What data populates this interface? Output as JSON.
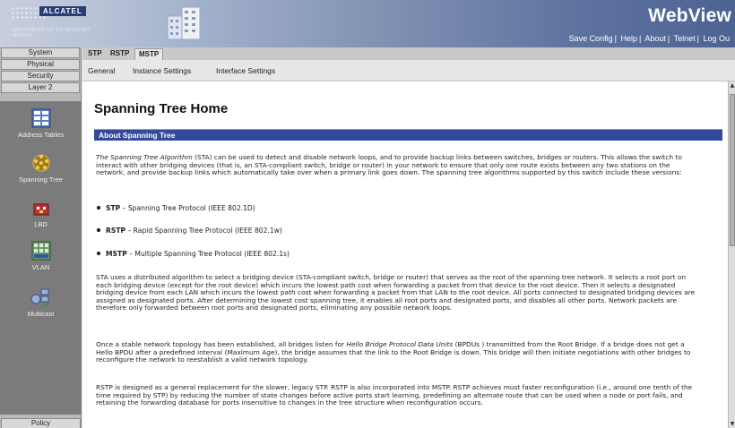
{
  "header": {
    "brand_logo": "ALCATEL",
    "brand_tagline": "ARCHITECTS OF AN INTERNET WORLD",
    "app_title": "WebView",
    "links": [
      "Save Config",
      "Help",
      "About",
      "Telnet",
      "Log Ou"
    ],
    "separator": "|"
  },
  "sidebar": {
    "tabs": [
      "System",
      "Physical",
      "Security",
      "Layer 2"
    ],
    "items": [
      {
        "label": "Address Tables",
        "icon": "address-table-icon"
      },
      {
        "label": "Spanning Tree",
        "icon": "spanning-tree-icon"
      },
      {
        "label": "LBD",
        "icon": "lbd-icon"
      },
      {
        "label": "VLAN",
        "icon": "vlan-icon"
      },
      {
        "label": "Multicast",
        "icon": "multicast-icon"
      }
    ],
    "bottom_tab": "Policy"
  },
  "tabs": {
    "items": [
      "STP",
      "RSTP",
      "MSTP"
    ],
    "active": "MSTP"
  },
  "subtabs": [
    "General",
    "Instance Settings",
    "Interface Settings"
  ],
  "content": {
    "page_title": "Spanning Tree Home",
    "section_title": "About Spanning Tree",
    "intro_italic": "The Spanning Tree Algorithm",
    "intro_rest": " (STA) can be used to detect and disable network loops, and to provide backup links between switches, bridges or routers. This allows the switch to interact with other bridging devices (that is, an STA-compliant switch, bridge or router) in your network to ensure that only one route exists between any two stations on the network, and provide backup links which automatically take over when a primary link goes down. The spanning tree algorithms supported by this switch include these versions:",
    "bullets": [
      {
        "term": "STP",
        "desc": " – Spanning Tree Protocol (IEEE 802.1D)"
      },
      {
        "term": "RSTP",
        "desc": " – Rapid Spanning Tree Protocol (IEEE 802.1w)"
      },
      {
        "term": "MSTP",
        "desc": " – Multiple Spanning Tree Protocol (IEEE 802.1s)"
      }
    ],
    "para2": "STA uses a distributed algorithm to select a bridging device (STA-compliant switch, bridge or router) that serves as the root of the spanning tree network. It selects a root port on each bridging device (except for the root device) which incurs the lowest path cost when forwarding a packet from that device to the root device. Then it selects a designated bridging device from each LAN which incurs the lowest path cost when forwarding a packet from that LAN to the root device. All ports connected to designated bridging devices are assigned as designated ports. After determining the lowest cost spanning tree, it enables all root ports and designated ports, and disables all other ports. Network packets are therefore only forwarded between root ports and designated ports, eliminating any possible network loops.",
    "para3_a": "Once a stable network topology has been established, all bridges listen for ",
    "para3_italic": "Hello Bridge Protocol Data Units",
    "para3_b": " (BPDUs ) transmitted from the Root Bridge. If a bridge does not get a Hello BPDU after a predefined interval (Maximum Age), the bridge assumes that the link to the Root Bridge is down. This bridge will then initiate negotiations with other bridges to reconfigure the network to reestablish a valid network topology.",
    "para4": "RSTP is designed as a general replacement for the slower, legacy STP. RSTP is also incorporated into MSTP. RSTP achieves must faster reconfiguration (i.e., around one tenth of the time required by STP) by reducing the number of state changes before active ports start learning, predefining an alternate route that can be used when a node or port fails, and retaining the forwarding database for ports insensitive to changes in the tree structure when reconfiguration occurs."
  }
}
